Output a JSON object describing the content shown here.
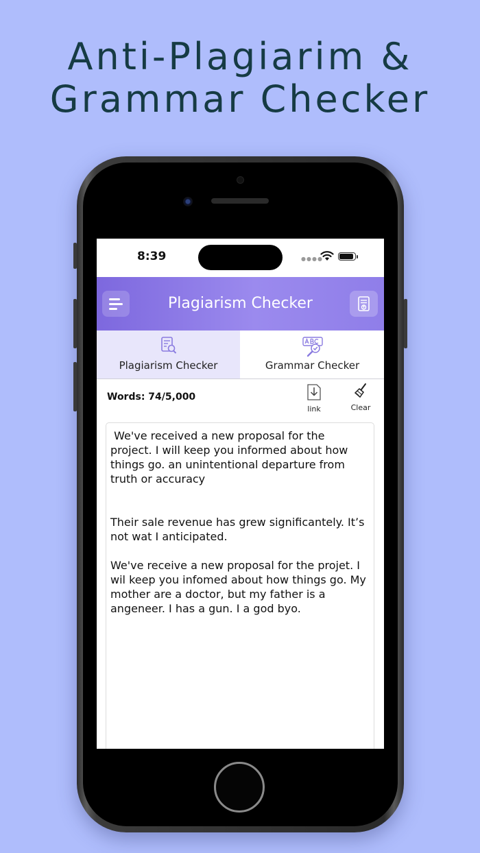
{
  "headline": {
    "line1": "Anti-Plagiarim &",
    "line2": "Grammar Checker"
  },
  "status_bar": {
    "time": "8:39"
  },
  "appbar": {
    "title": "Plagiarism Checker",
    "menu_icon": "hamburger-menu-icon",
    "action_icon": "document-upload-icon"
  },
  "tabs": [
    {
      "label": "Plagiarism Checker",
      "icon": "document-search-icon",
      "selected": true
    },
    {
      "label": "Grammar Checker",
      "icon": "abc-check-icon",
      "selected": false
    }
  ],
  "toolbar": {
    "words": "Words: 74/5,000",
    "link_label": "link",
    "clear_label": "Clear"
  },
  "editor": {
    "paragraphs": [
      " We've received a new proposal for the project. I will keep you informed about how things go. an unintentional departure from truth or accuracy",
      "Their sale revenue has grew significantely. It’s not wat I anticipated.",
      "We've receive a new proposal for the projet. I wil keep you infomed about how things go. My mother are a doctor, but my father is a angeneer. I has a gun. I a god byo."
    ]
  },
  "colors": {
    "background": "#afbdfc",
    "headline": "#163b44",
    "appbar_start": "#7d68de",
    "appbar_end": "#9b8aee",
    "selected_tab": "#e8e6fb"
  }
}
